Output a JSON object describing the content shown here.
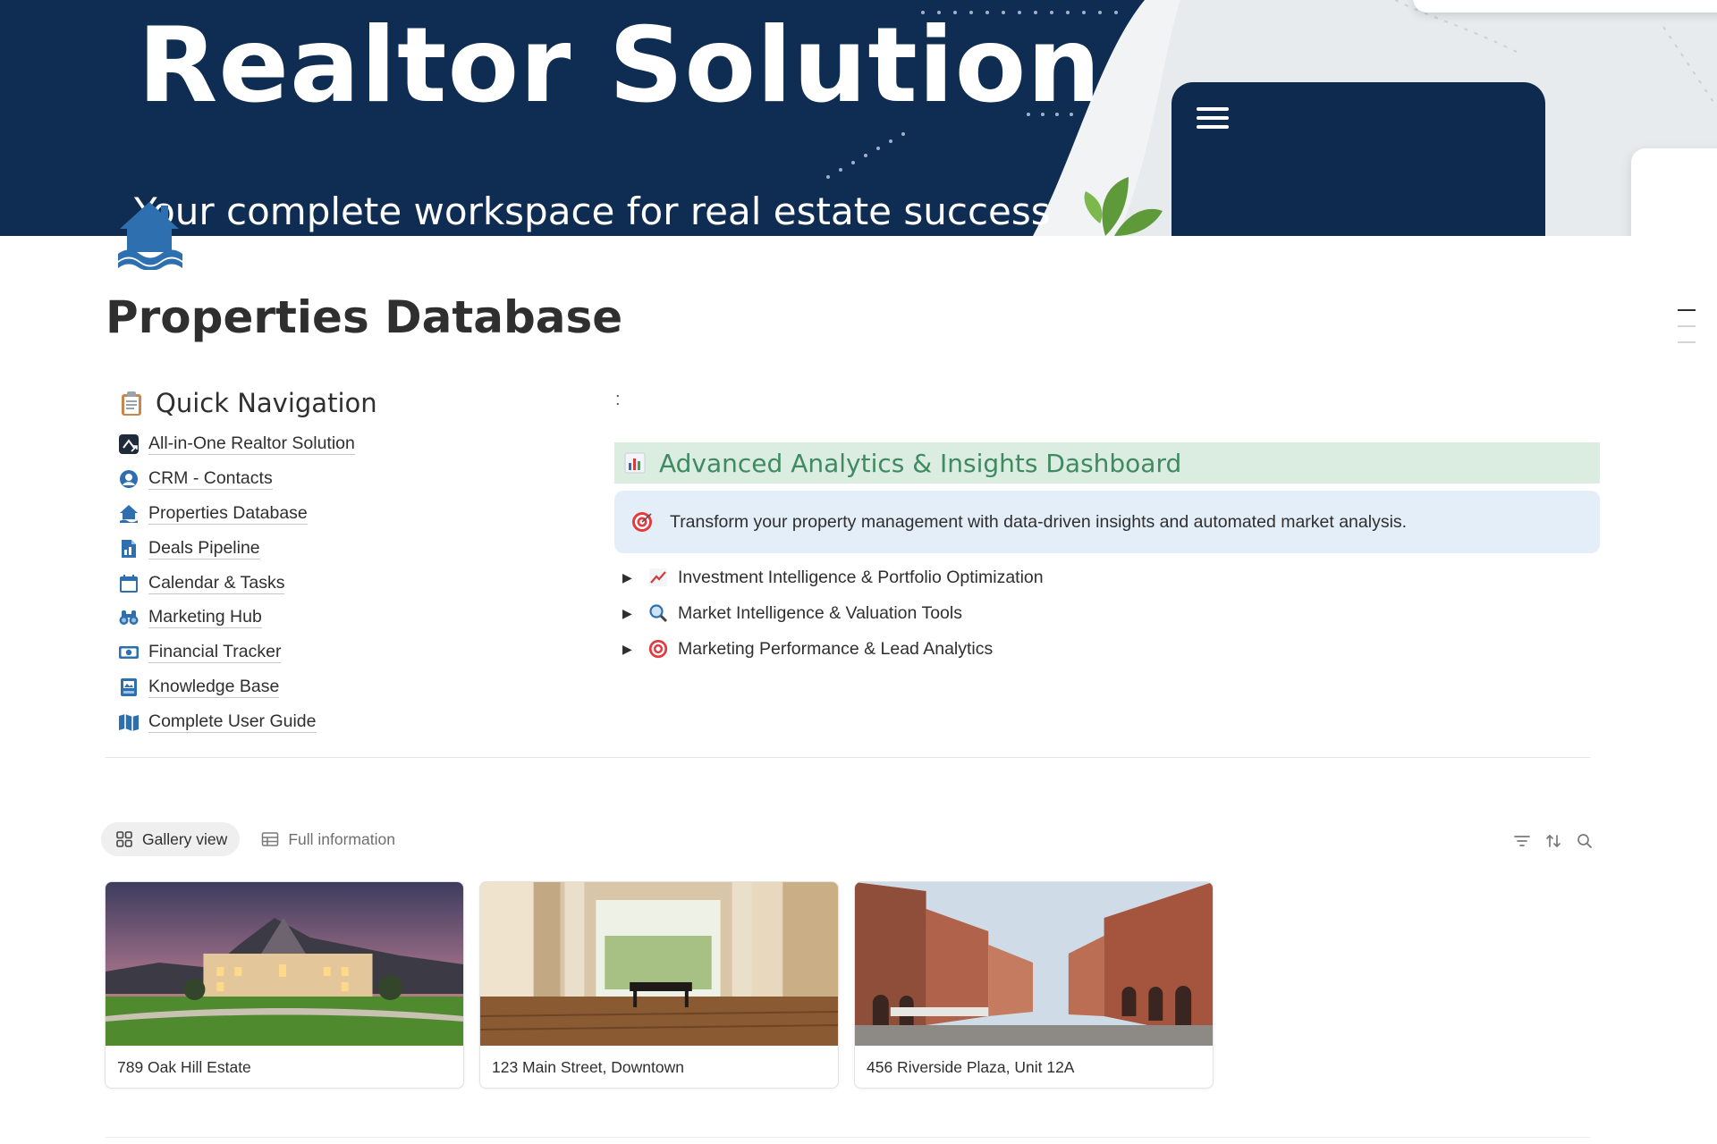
{
  "cover": {
    "title": "Realtor Solution",
    "subtitle": "Your complete workspace for real estate success"
  },
  "page": {
    "icon": "house-water-icon",
    "title": "Properties Database"
  },
  "quick_nav": {
    "heading_icon": "clipboard-icon",
    "heading": "Quick Navigation",
    "items": [
      {
        "icon": "realtor-app-icon",
        "label": "All-in-One Realtor Solution"
      },
      {
        "icon": "contact-person-icon",
        "label": "CRM - Contacts"
      },
      {
        "icon": "house-water-icon",
        "label": "Properties Database"
      },
      {
        "icon": "document-chart-icon",
        "label": "Deals Pipeline"
      },
      {
        "icon": "calendar-icon",
        "label": "Calendar & Tasks"
      },
      {
        "icon": "binoculars-icon",
        "label": "Marketing Hub"
      },
      {
        "icon": "money-bill-icon",
        "label": "Financial Tracker"
      },
      {
        "icon": "book-icon",
        "label": "Knowledge Base"
      },
      {
        "icon": "map-icon",
        "label": "Complete User Guide"
      }
    ]
  },
  "column_separator": ":",
  "analytics": {
    "heading_icon": "bar-chart-icon",
    "heading": "Advanced Analytics & Insights Dashboard",
    "callout_icon": "target-icon",
    "callout": "Transform your property management with data-driven insights and automated market analysis.",
    "toggles": [
      {
        "icon": "trending-up-icon",
        "label": "Investment Intelligence & Portfolio Optimization"
      },
      {
        "icon": "magnifier-icon",
        "label": "Market Intelligence & Valuation Tools"
      },
      {
        "icon": "target-icon",
        "label": "Marketing Performance & Lead Analytics"
      }
    ]
  },
  "views": {
    "tabs": [
      {
        "icon": "gallery-grid-icon",
        "label": "Gallery view",
        "active": true
      },
      {
        "icon": "table-icon",
        "label": "Full information",
        "active": false
      }
    ],
    "tools": [
      "filter-icon",
      "sort-icon",
      "search-icon"
    ]
  },
  "gallery": {
    "cards": [
      {
        "image": "mansion-photo",
        "title": "789 Oak Hill Estate"
      },
      {
        "image": "interior-piano-photo",
        "title": "123 Main Street, Downtown"
      },
      {
        "image": "plaza-buildings-photo",
        "title": "456 Riverside Plaza, Unit 12A"
      }
    ]
  },
  "colors": {
    "cover_navy": "#0f2d52",
    "house_icon_blue": "#2e6fb0",
    "analytics_green": "#3f8a61",
    "analytics_bg": "#dbece0",
    "callout_bg": "#e3eef8"
  }
}
